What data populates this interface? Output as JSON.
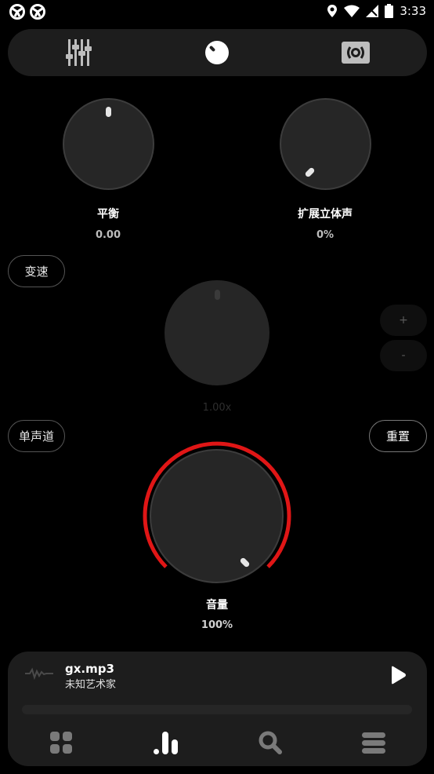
{
  "status": {
    "time": "3:33"
  },
  "tabs": [
    {
      "icon": "equalizer-sliders-icon",
      "active": false
    },
    {
      "icon": "effects-knob-icon",
      "active": true
    },
    {
      "icon": "surround-speaker-icon",
      "active": false
    }
  ],
  "controls": {
    "balance": {
      "label": "平衡",
      "value": "0.00"
    },
    "stereo_expand": {
      "label": "扩展立体声",
      "value": "0%"
    },
    "speed": {
      "button_label": "变速",
      "value": "1.00x",
      "plus_label": "+",
      "minus_label": "-"
    },
    "mono_label": "单声道",
    "reset_label": "重置",
    "volume": {
      "label": "音量",
      "value": "100%",
      "level": 1.0
    }
  },
  "player": {
    "title": "gx.mp3",
    "artist": "未知艺术家",
    "progress": 0
  },
  "nav": [
    {
      "icon": "grid-icon",
      "active": false
    },
    {
      "icon": "bars-chart-icon",
      "active": true
    },
    {
      "icon": "search-icon",
      "active": false
    },
    {
      "icon": "menu-icon",
      "active": false
    }
  ],
  "colors": {
    "accent": "#e01616",
    "background": "#000000",
    "surface": "#1d1d1d"
  }
}
